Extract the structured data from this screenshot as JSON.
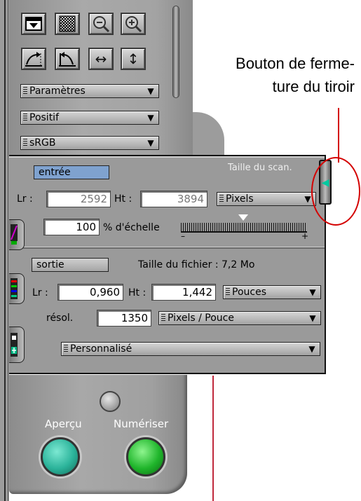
{
  "toolbar": {
    "row1_icons": [
      "invert-icon",
      "checker-icon",
      "zoom-out-icon",
      "zoom-in-icon"
    ],
    "row2_icons": [
      "rotate-right-icon",
      "rotate-left-icon",
      "flip-horizontal-icon",
      "flip-vertical-icon"
    ]
  },
  "menus": {
    "parametres": "Paramètres",
    "positif": "Positif",
    "srgb": "sRGB"
  },
  "drawer": {
    "title": "Taille du scan.",
    "input_label": "entrée",
    "lr_label": "Lr :",
    "lr_value": "2592",
    "ht_label": "Ht :",
    "ht_value": "3894",
    "input_unit": "Pixels",
    "scale_value": "100",
    "scale_label": "% d'échelle",
    "slider_minus": "–",
    "slider_plus": "+",
    "output_label": "sortie",
    "file_size": "Taille du fichier : 7,2 Mo",
    "out_lr_label": "Lr :",
    "out_lr_value": "0,960",
    "out_ht_label": "Ht :",
    "out_ht_value": "1,442",
    "out_unit": "Pouces",
    "resolution_label": "résol.",
    "resolution_value": "1350",
    "resolution_unit": "Pixels / Pouce",
    "preset": "Personnalisé"
  },
  "buttons": {
    "preview": "Aperçu",
    "scan": "Numériser"
  },
  "annotation": {
    "line1": "Bouton de ferme-",
    "line2": "ture du tiroir"
  },
  "colors": {
    "annotation_red": "#d40000",
    "preview_button": "#2bb39a",
    "scan_button": "#1fb52b",
    "close_arrow": "#00c9a0",
    "input_chip": "#7fa2cf"
  }
}
